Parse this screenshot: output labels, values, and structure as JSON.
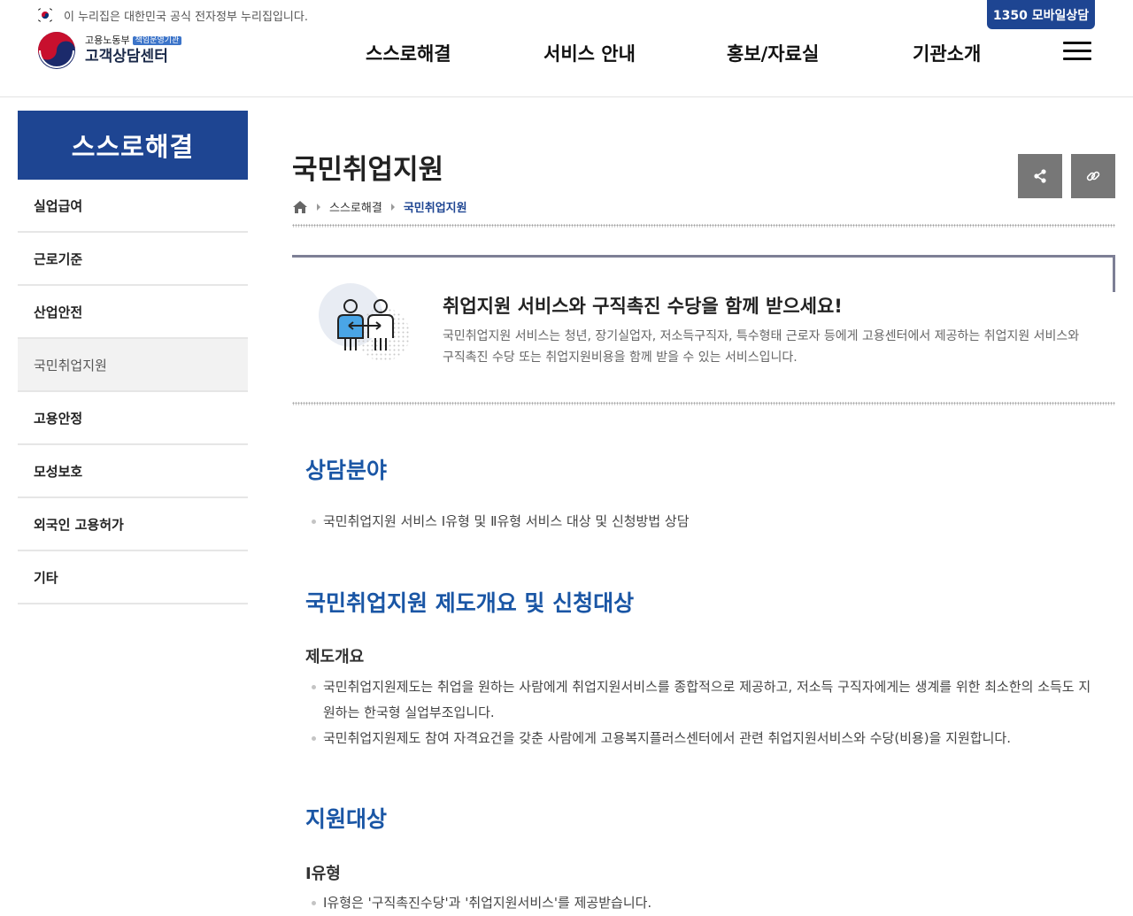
{
  "header": {
    "gov_notice": "이 누리집은 대한민국 공식 전자정부 누리집입니다.",
    "mobile_button": "1350 모바일상담",
    "logo_ministry": "고용노동부",
    "logo_badge": "책임운영기관",
    "logo_center": "고객상담센터",
    "nav": [
      "스스로해결",
      "서비스 안내",
      "홍보/자료실",
      "기관소개"
    ],
    "icons": {
      "flag": "korea-flag-icon",
      "menu": "hamburger-menu-icon"
    }
  },
  "sidebar": {
    "title": "스스로해결",
    "items": [
      "실업급여",
      "근로기준",
      "산업안전",
      "국민취업지원",
      "고용안정",
      "모성보호",
      "외국인 고용허가",
      "기타"
    ],
    "active_index": 3
  },
  "page": {
    "title": "국민취업지원",
    "breadcrumb": {
      "home_icon": "home-icon",
      "section": "스스로해결",
      "current": "국민취업지원"
    },
    "tools": {
      "share_icon": "share-icon",
      "link_icon": "link-icon"
    }
  },
  "intro": {
    "icon": "job-support-people-icon",
    "heading": "취업지원 서비스와 구직촉진 수당을 함께 받으세요!",
    "description": "국민취업지원 서비스는 청년, 장기실업자, 저소득구직자, 특수형태 근로자 등에게 고용센터에서 제공하는 취업지원 서비스와 구직촉진 수당 또는 취업지원비용을 함께 받을 수 있는 서비스입니다."
  },
  "sections": {
    "counsel": {
      "title": "상담분야",
      "items": [
        "국민취업지원 서비스 Ⅰ유형 및 Ⅱ유형 서비스 대상 및 신청방법 상담"
      ]
    },
    "overview": {
      "title": "국민취업지원 제도개요 및 신청대상",
      "subtitle": "제도개요",
      "items": [
        "국민취업지원제도는 취업을 원하는 사람에게 취업지원서비스를 종합적으로 제공하고, 저소득 구직자에게는 생계를 위한 최소한의 소득도 지원하는 한국형 실업부조입니다.",
        "국민취업지원제도 참여 자격요건을 갖춘 사람에게 고용복지플러스센터에서 관련 취업지원서비스와 수당(비용)을 지원합니다."
      ]
    },
    "target": {
      "title": "지원대상",
      "subtitle": "Ⅰ유형",
      "items": [
        "Ⅰ유형은 '구직촉진수당'과 '취업지원서비스'를 제공받습니다."
      ]
    }
  },
  "colors": {
    "primary": "#1e4592",
    "section_title": "#1a56a5",
    "tool_button": "#777777"
  }
}
